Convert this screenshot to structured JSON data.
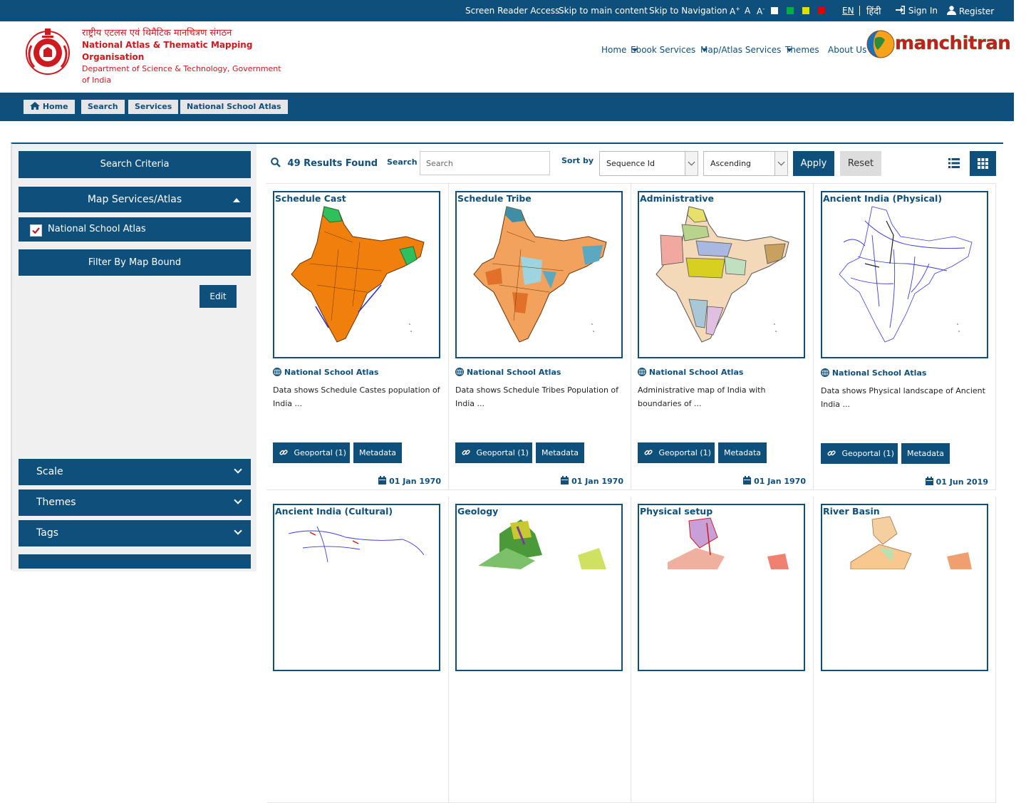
{
  "topbar": {
    "screen_reader": "Screen Reader Access",
    "skip_main": "Skip to main content",
    "skip_nav": "Skip to Navigation",
    "font_up": "A",
    "font_up_sup": "+",
    "font_normal": "A",
    "font_down": "A",
    "font_down_sup": "-",
    "contrast_colors": [
      "#ffffff",
      "#00b140",
      "#e6dc00",
      "#e00000"
    ],
    "lang_en": "EN",
    "lang_hi": "हिंदी",
    "signin": "Sign In",
    "register": "Register"
  },
  "header": {
    "org_hindi": "राष्ट्रीय एटलस एवं थिमैटिक मानचित्रण संगठन",
    "org_english": "National Atlas & Thematic Mapping Organisation",
    "department": "Department of Science & Technology, Government of India",
    "nav": [
      "Home",
      "Ebook Services",
      "Map/Atlas Services",
      "Themes",
      "About Us"
    ],
    "brand": "manchitran"
  },
  "breadcrumb": [
    "Home",
    "Search",
    "Services",
    "National School Atlas"
  ],
  "sidebar": {
    "search_criteria": "Search Criteria",
    "map_services": "Map Services/Atlas",
    "national_school_atlas": "National School Atlas",
    "filter_map_bound": "Filter By Map Bound",
    "edit": "Edit",
    "scale": "Scale",
    "themes": "Themes",
    "tags": "Tags"
  },
  "toolbar": {
    "results": "49 Results Found",
    "search_label": "Search",
    "search_placeholder": "Search",
    "sort_label": "Sort by",
    "sort_value": "Sequence Id",
    "order_value": "Ascending",
    "apply": "Apply",
    "reset": "Reset"
  },
  "cards": [
    {
      "title": "Schedule Cast",
      "category": "National School Atlas",
      "description": "Data shows Schedule Castes population of India ...",
      "geoportal": "Geoportal (1)",
      "metadata": "Metadata",
      "date": "01 Jan 1970"
    },
    {
      "title": "Schedule Tribe",
      "category": "National School Atlas",
      "description": "Data shows Schedule Tribes Population of India ...",
      "geoportal": "Geoportal (1)",
      "metadata": "Metadata",
      "date": "01 Jan 1970"
    },
    {
      "title": "Administrative",
      "category": "National School Atlas",
      "description": "Administrative map of India with boundaries of ...",
      "geoportal": "Geoportal (1)",
      "metadata": "Metadata",
      "date": "01 Jan 1970"
    },
    {
      "title": "Ancient India (Physical)",
      "category": "National School Atlas",
      "description": "Data shows Physical landscape of Ancient India ...",
      "geoportal": "Geoportal (1)",
      "metadata": "Metadata",
      "date": "01 Jun 2019"
    },
    {
      "title": "Ancient India (Cultural)"
    },
    {
      "title": "Geology"
    },
    {
      "title": "Physical setup"
    },
    {
      "title": "River Basin"
    }
  ]
}
